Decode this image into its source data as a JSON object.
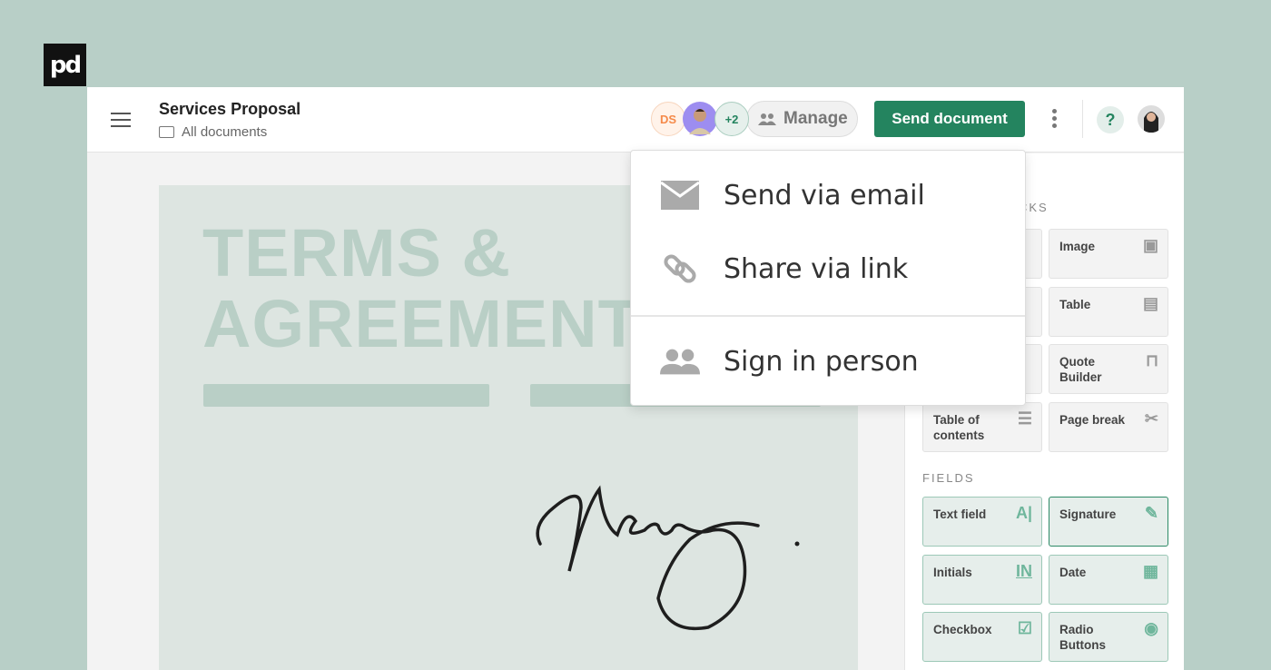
{
  "logo": {
    "text": "pd"
  },
  "header": {
    "title": "Services Proposal",
    "breadcrumb": "All documents",
    "avatar_initials": "DS",
    "more_count": "+2",
    "manage_label": "Manage",
    "send_label": "Send document",
    "help_label": "?"
  },
  "document": {
    "heading_line1": "TERMS &",
    "heading_line2": "AGREEMENT"
  },
  "dropdown": {
    "items": [
      {
        "label": "Send via email",
        "icon": "mail-icon"
      },
      {
        "label": "Share via link",
        "icon": "link-icon"
      },
      {
        "label": "Sign in person",
        "icon": "people-icon"
      }
    ]
  },
  "sidebar": {
    "blocks_title": "CKS",
    "blocks": [
      {
        "label": "Image",
        "icon": "image-icon"
      },
      {
        "label": "Table",
        "icon": "table-icon"
      },
      {
        "label": "Quote Builder",
        "icon": "bag-icon"
      },
      {
        "label": "Table of contents",
        "icon": "list-icon"
      },
      {
        "label": "Page break",
        "icon": "scissors-icon"
      }
    ],
    "fields_title": "FIELDS",
    "fields": [
      {
        "label": "Text field",
        "icon": "A|"
      },
      {
        "label": "Signature",
        "icon": "pen-icon"
      },
      {
        "label": "Initials",
        "icon": "IN"
      },
      {
        "label": "Date",
        "icon": "calendar-icon"
      },
      {
        "label": "Checkbox",
        "icon": "checkbox-icon"
      },
      {
        "label": "Radio Buttons",
        "icon": "radio-icon"
      }
    ]
  },
  "colors": {
    "accent": "#24845f",
    "background": "#b8cfc7"
  }
}
